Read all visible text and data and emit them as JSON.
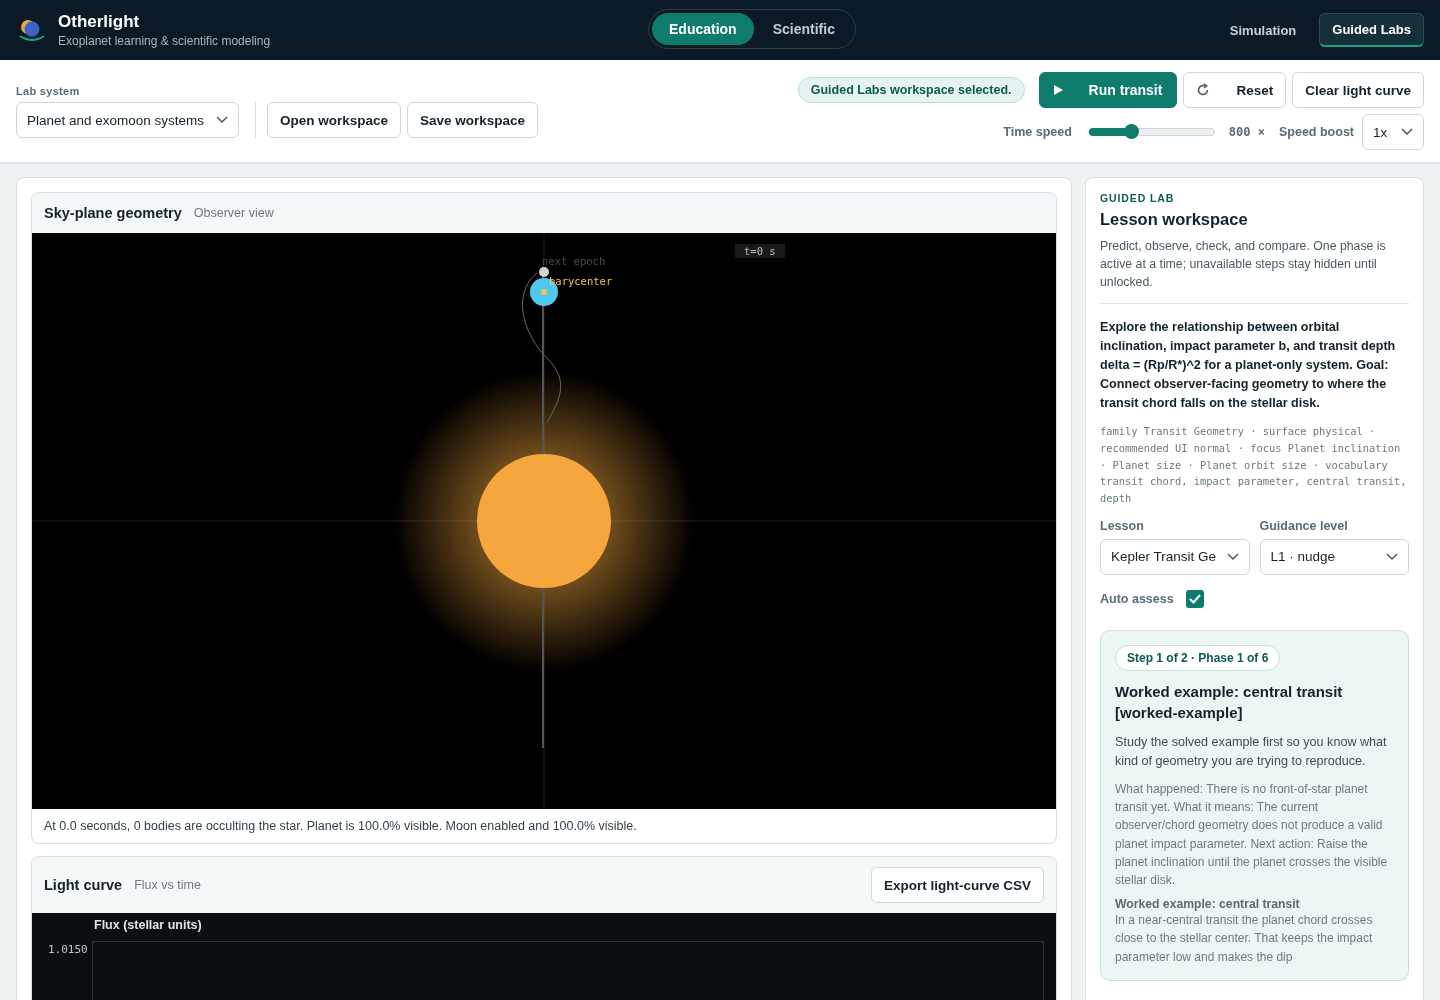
{
  "app": {
    "name": "Otherlight",
    "tagline": "Exoplanet learning & scientific modeling"
  },
  "modes": [
    {
      "label": "Education",
      "selected": true
    },
    {
      "label": "Scientific",
      "selected": false
    }
  ],
  "nav": [
    {
      "label": "Simulation",
      "selected": false
    },
    {
      "label": "Guided Labs",
      "selected": true
    }
  ],
  "toolbar": {
    "lab_system_label": "Lab system",
    "lab_system": "Planet and exomoon systems",
    "buttons": [
      "Open workspace",
      "Save workspace"
    ],
    "status": "Guided Labs workspace selected.",
    "actions": [
      {
        "kind": "primary",
        "label": "Run transit"
      },
      {
        "kind": "reset",
        "label": "Reset"
      },
      {
        "kind": "plain",
        "label": "Clear light curve"
      }
    ],
    "time_speed": {
      "label": "Time speed",
      "level": 0.34,
      "reading": "800 ×"
    },
    "speed_boost": {
      "label": "Speed boost",
      "value": "1x"
    }
  },
  "sky": {
    "title": "Sky-plane geometry",
    "subtitle": "Observer view",
    "time_label": "t=0 s",
    "epoch_label": "next epoch",
    "barycenter_label": "barycenter",
    "caption": "At 0.0 seconds, 0 bodies are occulting the star. Planet is 100.0% visible. Moon enabled and 100.0% visible."
  },
  "light_curve": {
    "title": "Light curve",
    "subtitle": "Flux vs time",
    "export": "Export light-curve CSV",
    "axis_title": "Flux (stellar units)",
    "tick_label": "1.0150"
  },
  "lesson": {
    "eyebrow": "GUIDED LAB",
    "title": "Lesson workspace",
    "intro": "Predict, observe, check, and compare. One phase is active at a time; unavailable steps stay hidden until unlocked.",
    "goal": "Explore the relationship between orbital inclination, impact parameter b, and transit depth delta = (Rp/R*)^2 for a planet-only system. Goal: Connect observer-facing geometry to where the transit chord falls on the stellar disk.",
    "meta": "family Transit Geometry · surface physical · recommended UI normal · focus Planet inclination · Planet size · Planet orbit size · vocabulary transit chord, impact parameter, central transit, depth",
    "lesson_label": "Lesson",
    "lesson_value": "Kepler Transit Ge",
    "guidance_label": "Guidance level",
    "guidance_value": "L1 · nudge",
    "auto_assess_label": "Auto assess",
    "auto_assess": true,
    "step": {
      "badge": "Step 1 of 2 · Phase 1 of 6",
      "title": "Worked example: central transit [worked-example]",
      "body": "Study the solved example first so you know what kind of geometry you are trying to reproduce.",
      "feedback": "What happened: There is no front-of-star planet transit yet. What it means: The current observer/chord geometry does not produce a valid planet impact parameter. Next action: Raise the planet inclination until the planet crosses the visible stellar disk.",
      "example_title": "Worked example: central transit",
      "example_body": "In a near-central transit the planet chord crosses close to the stellar center. That keeps the impact parameter low and makes the dip"
    }
  }
}
